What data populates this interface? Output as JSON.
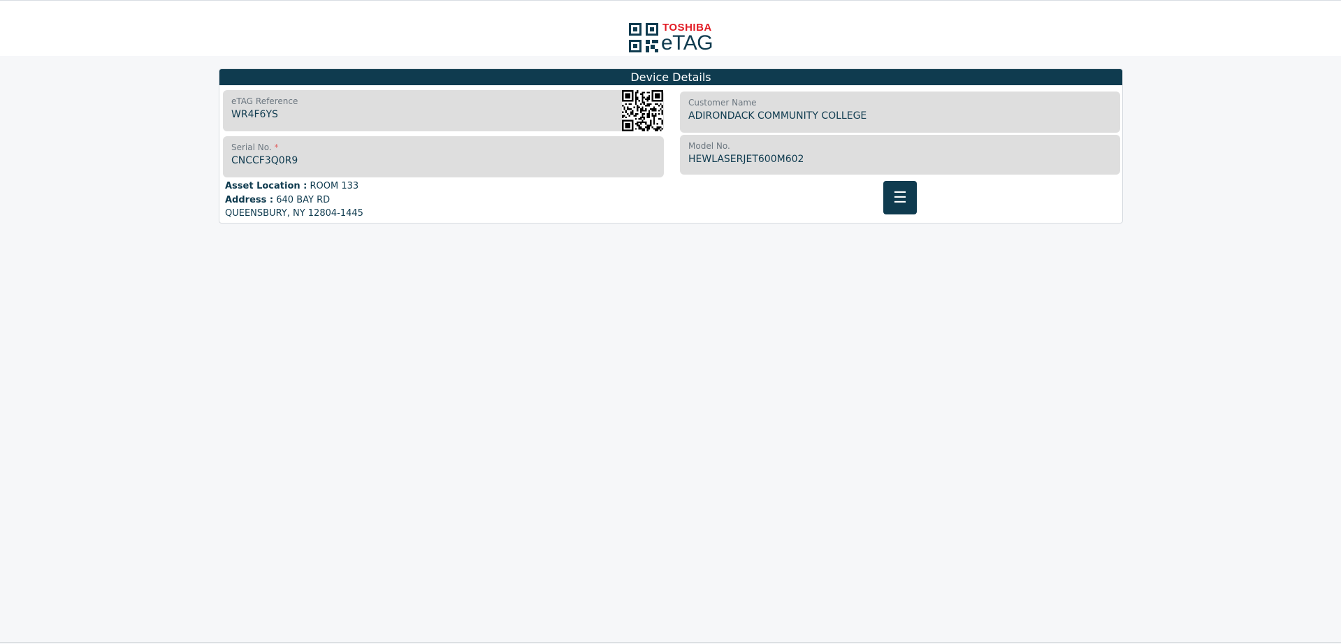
{
  "logo": {
    "brand": "TOSHIBA",
    "product": "eTAG"
  },
  "card": {
    "title": "Device Details"
  },
  "fields": {
    "etag_reference": {
      "label": "eTAG Reference",
      "value": "WR4F6YS"
    },
    "serial_no": {
      "label": "Serial No.",
      "required_mark": "*",
      "value": "CNCCF3Q0R9"
    },
    "customer_name": {
      "label": "Customer Name",
      "value": "ADIRONDACK COMMUNITY COLLEGE"
    },
    "model_no": {
      "label": "Model No.",
      "value": "HEWLASERJET600M602"
    }
  },
  "info": {
    "asset_location_label": "Asset Location :",
    "asset_location_value": "ROOM 133",
    "address_label": "Address :",
    "address_line1": "640 BAY RD",
    "address_line2": "QUEENSBURY, NY 12804-1445"
  },
  "menu_button": {
    "icon": "hamburger-menu-icon",
    "glyph": "☰"
  },
  "colors": {
    "primary": "#0f3b4f",
    "brand_red": "#e21b24",
    "field_bg": "#dedede",
    "page_bg": "#f6f7f9"
  }
}
